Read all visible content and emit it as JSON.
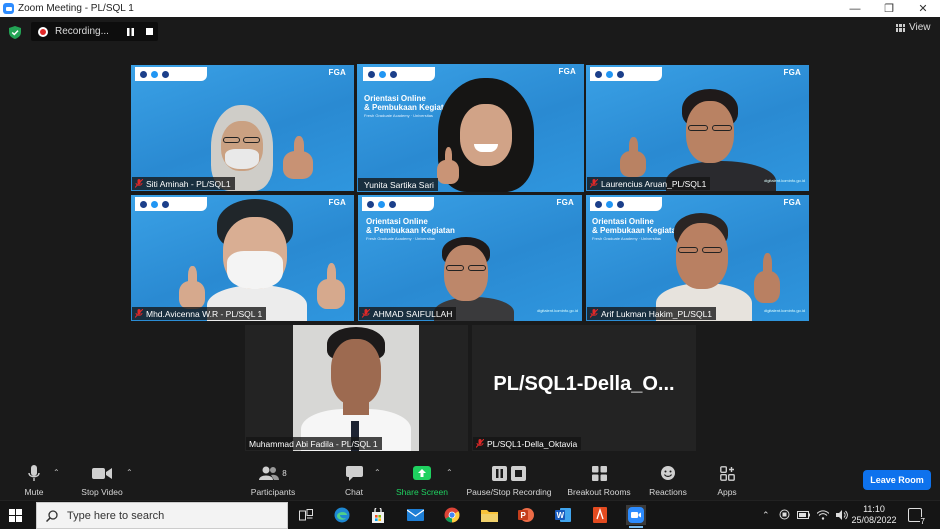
{
  "window": {
    "title": "Zoom Meeting - PL/SQL 1",
    "controls": [
      "minimize-icon",
      "restore-icon",
      "close-icon"
    ]
  },
  "recording": {
    "status": "Recording...",
    "pause_icon": "pause-icon",
    "stop_icon": "stop-icon"
  },
  "view": {
    "label": "View",
    "icon": "grid-view-icon"
  },
  "participants": [
    {
      "name": "Siti Aminah - PL/SQL1",
      "muted": true,
      "speaking": false
    },
    {
      "name": "Yunita Sartika Sari",
      "muted": false,
      "speaking": true
    },
    {
      "name": "Laurencius Aruan_PL/SQL1",
      "muted": true,
      "speaking": false
    },
    {
      "name": "Mhd.Avicenna W.R - PL/SQL 1",
      "muted": true,
      "speaking": false
    },
    {
      "name": "AHMAD SAIFULLAH",
      "muted": true,
      "speaking": false
    },
    {
      "name": "Arif Lukman Hakim_PL/SQL1",
      "muted": true,
      "speaking": false
    },
    {
      "name": "Muhammad Abi Fadila - PL/SQL 1",
      "muted": false,
      "speaking": false
    },
    {
      "name": "PL/SQL1-Della_Oktavia",
      "muted": true,
      "speaking": false,
      "display_name": "PL/SQL1-Della_O..."
    }
  ],
  "background": {
    "brand": "FGA",
    "headline1": "Orientasi Online",
    "headline2": "& Pembukaan Kegiatan"
  },
  "toolbar": {
    "mute": "Mute",
    "stop_video": "Stop Video",
    "participants": "Participants",
    "participants_count": "8",
    "chat": "Chat",
    "share_screen": "Share Screen",
    "pause_recording": "Pause/Stop Recording",
    "breakout": "Breakout Rooms",
    "reactions": "Reactions",
    "apps": "Apps",
    "leave": "Leave Room"
  },
  "taskbar": {
    "search_placeholder": "Type here to search",
    "time": "11:10",
    "date": "25/08/2022",
    "notifications": "7"
  },
  "colors": {
    "accent": "#0e72ed",
    "zoom_blue": "#2D8CFF",
    "speaking_border": "#e8e041",
    "share_green": "#1fd160",
    "muted_red": "#e02828"
  }
}
